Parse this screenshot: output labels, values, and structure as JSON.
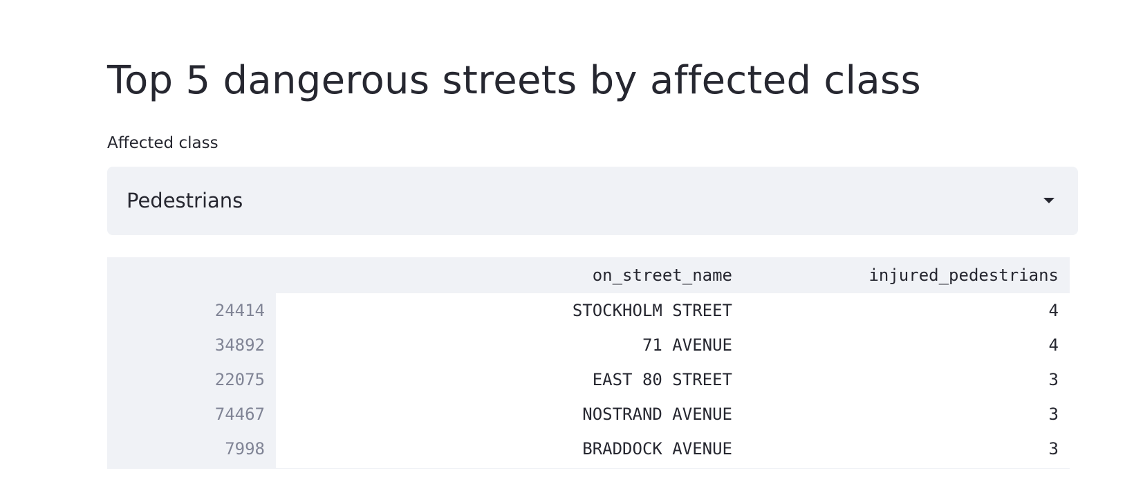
{
  "page": {
    "title": "Top 5 dangerous streets by affected class"
  },
  "selector": {
    "label": "Affected class",
    "selected_value": "Pedestrians"
  },
  "table": {
    "columns": [
      "",
      "on_street_name",
      "injured_pedestrians"
    ],
    "rows": [
      {
        "index": "24414",
        "on_street_name": "STOCKHOLM STREET",
        "injured_pedestrians": "4"
      },
      {
        "index": "34892",
        "on_street_name": "71 AVENUE",
        "injured_pedestrians": "4"
      },
      {
        "index": "22075",
        "on_street_name": "EAST 80 STREET",
        "injured_pedestrians": "3"
      },
      {
        "index": "74467",
        "on_street_name": "NOSTRAND AVENUE",
        "injured_pedestrians": "3"
      },
      {
        "index": "7998",
        "on_street_name": "BRADDOCK AVENUE",
        "injured_pedestrians": "3"
      }
    ]
  },
  "colors": {
    "text": "#262730",
    "muted": "#808495",
    "widget_bg": "#f0f2f6"
  },
  "icons": {
    "select_chevron": "caret-down-icon"
  }
}
